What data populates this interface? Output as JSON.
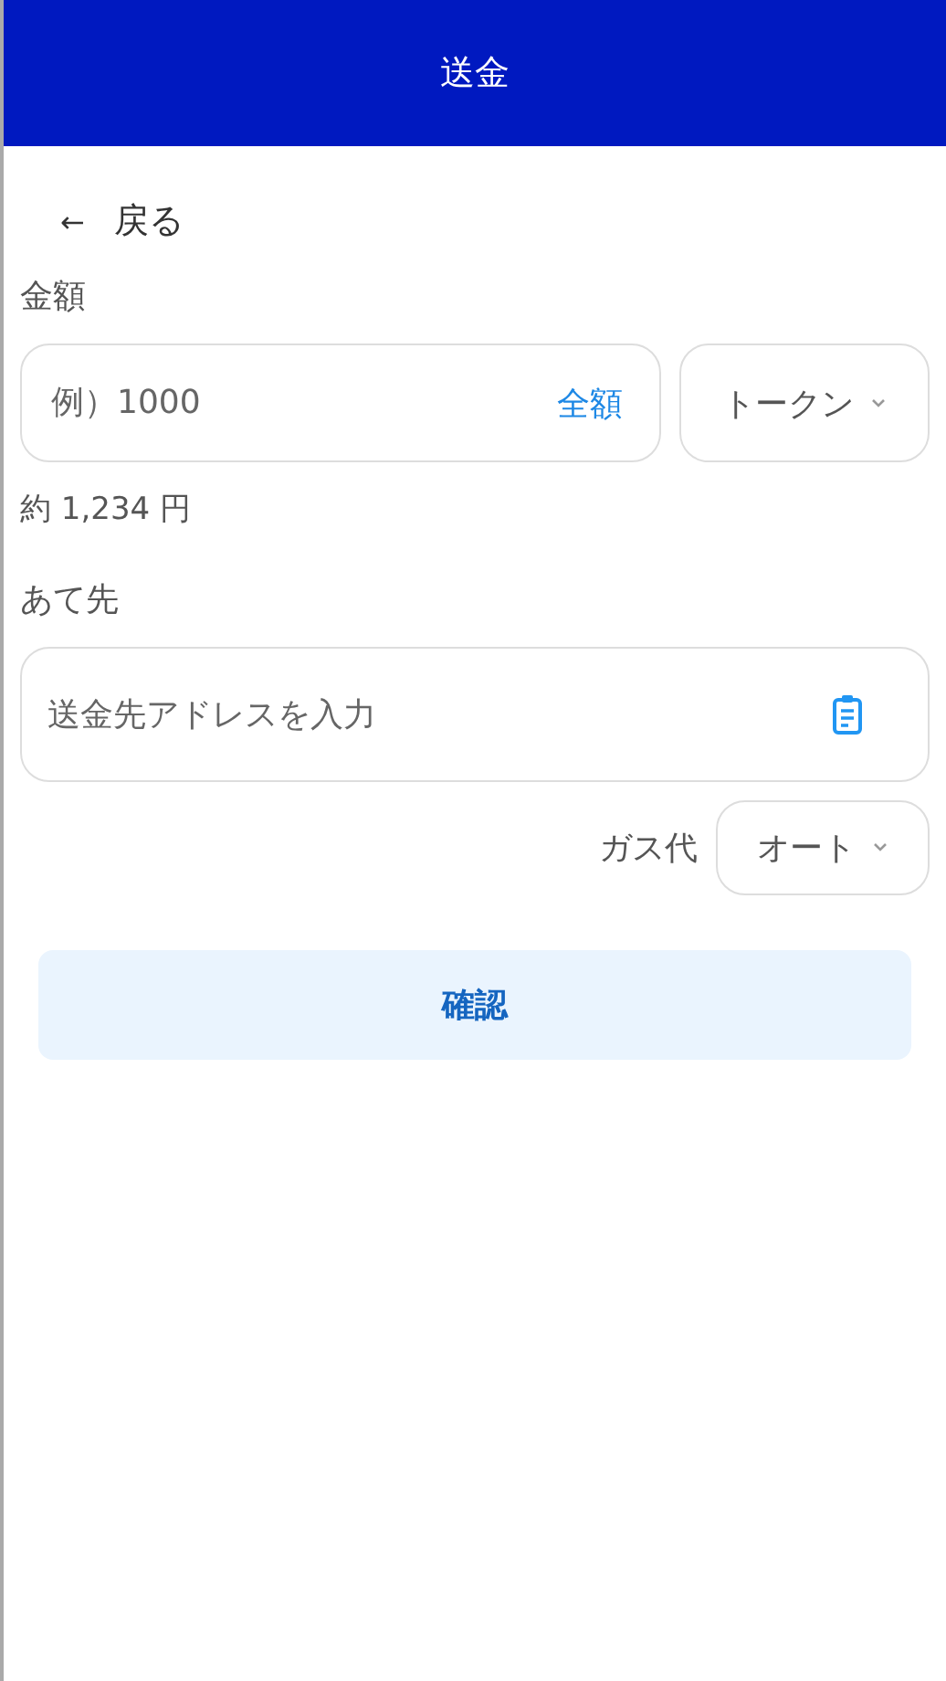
{
  "header": {
    "title": "送金"
  },
  "back": {
    "arrow": "←",
    "label": "戻る"
  },
  "amount": {
    "label": "金額",
    "placeholder": "例）1000",
    "max_button": "全額",
    "token_select": "トークン",
    "approx": "約 1,234 円"
  },
  "recipient": {
    "label": "あて先",
    "placeholder": "送金先アドレスを入力"
  },
  "gas": {
    "label": "ガス代",
    "select": "オート"
  },
  "confirm_button": "確認"
}
